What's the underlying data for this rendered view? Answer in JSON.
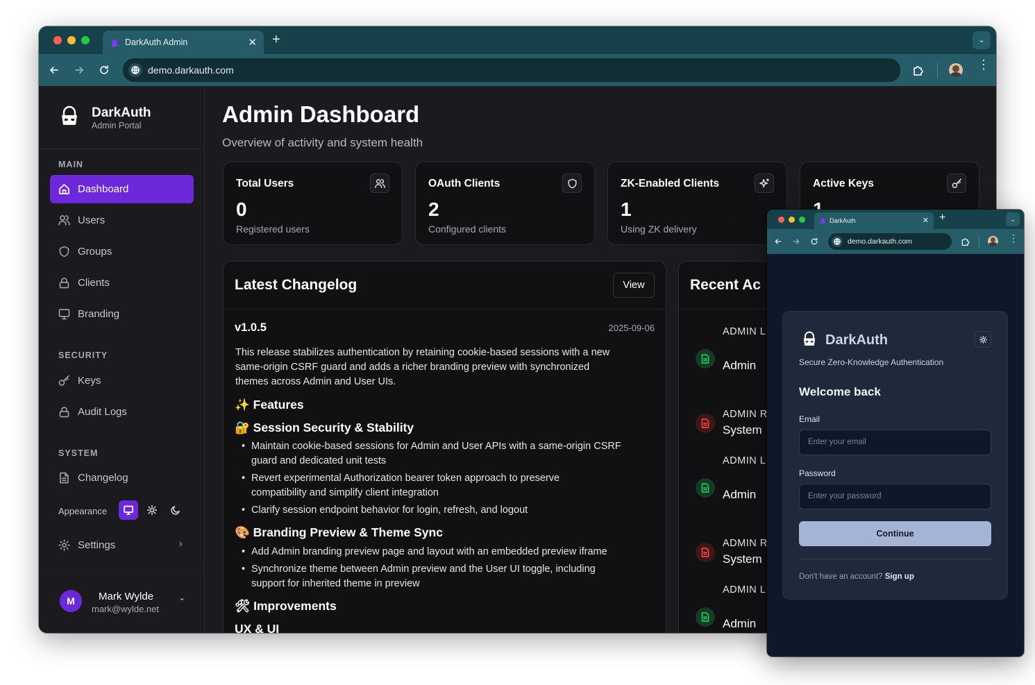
{
  "browser_main": {
    "tab_title": "DarkAuth Admin",
    "url": "demo.darkauth.com"
  },
  "sidebar": {
    "brand": "DarkAuth",
    "brand_sub": "Admin Portal",
    "sections": {
      "main": "MAIN",
      "security": "SECURITY",
      "system": "SYSTEM"
    },
    "items": [
      {
        "label": "Dashboard",
        "icon": "home-icon",
        "active": true
      },
      {
        "label": "Users",
        "icon": "users-icon"
      },
      {
        "label": "Groups",
        "icon": "shield-icon"
      },
      {
        "label": "Clients",
        "icon": "lock-icon"
      },
      {
        "label": "Branding",
        "icon": "monitor-icon"
      },
      {
        "label": "Keys",
        "icon": "key-icon"
      },
      {
        "label": "Audit Logs",
        "icon": "lock-icon"
      },
      {
        "label": "Changelog",
        "icon": "file-icon"
      }
    ],
    "appearance_label": "Appearance",
    "settings_label": "Settings",
    "user": {
      "initial": "M",
      "name": "Mark Wylde",
      "email": "mark@wylde.net"
    }
  },
  "header": {
    "title": "Admin Dashboard",
    "subtitle": "Overview of activity and system health"
  },
  "stats": [
    {
      "title": "Total Users",
      "value": "0",
      "sub": "Registered users",
      "icon": "users-icon"
    },
    {
      "title": "OAuth Clients",
      "value": "2",
      "sub": "Configured clients",
      "icon": "shield-icon"
    },
    {
      "title": "ZK-Enabled Clients",
      "value": "1",
      "sub": "Using ZK delivery",
      "icon": "sparkles-icon"
    },
    {
      "title": "Active Keys",
      "value": "1",
      "sub": "",
      "icon": "key-icon"
    }
  ],
  "changelog": {
    "title": "Latest Changelog",
    "view_label": "View",
    "version": "v1.0.5",
    "date": "2025-09-06",
    "intro": [
      "This release stabilizes authentication by retaining cookie-based sessions with a new",
      "same-origin CSRF guard and adds a richer branding preview with synchronized",
      "themes across Admin and User UIs."
    ],
    "features_heading": "✨ Features",
    "session_heading": "🔐 Session Security & Stability",
    "session_bullets": [
      [
        "Maintain cookie-based sessions for Admin and User APIs with a same-origin CSRF",
        "guard and dedicated unit tests"
      ],
      [
        "Revert experimental Authorization bearer token approach to preserve",
        "compatibility and simplify client integration"
      ],
      [
        "Clarify session endpoint behavior for login, refresh, and logout"
      ]
    ],
    "branding_heading": "🎨 Branding Preview & Theme Sync",
    "branding_bullets": [
      [
        "Add Admin branding preview page and layout with an embedded preview iframe"
      ],
      [
        "Synchronize theme between Admin preview and the User UI toggle, including",
        "support for inherited theme in preview"
      ]
    ],
    "improvements_heading": "🛠 Improvements",
    "ux_heading": "UX & UI"
  },
  "recent_activity": {
    "title": "Recent Ac",
    "items": [
      {
        "tag": "ADMIN L",
        "main": "Admin",
        "status": "success"
      },
      {
        "tag": "ADMIN R",
        "main": "System",
        "status": "error"
      },
      {
        "tag": "ADMIN L",
        "main": "Admin",
        "status": "success"
      },
      {
        "tag": "ADMIN R",
        "main": "System",
        "status": "error"
      },
      {
        "tag": "ADMIN L",
        "main": "Admin",
        "status": "success"
      }
    ]
  },
  "browser_popup": {
    "tab_title": "DarkAuth",
    "url": "demo.darkauth.com"
  },
  "login": {
    "brand": "DarkAuth",
    "tagline": "Secure Zero-Knowledge Authentication",
    "heading": "Welcome back",
    "email_label": "Email",
    "email_placeholder": "Enter your email",
    "password_label": "Password",
    "password_placeholder": "Enter your password",
    "continue_label": "Continue",
    "signup_prompt": "Don't have an account?",
    "signup_link": "Sign up"
  },
  "colors": {
    "accent": "#6d28d9",
    "chrome_bar": "#265c68",
    "success": "#22c55e",
    "error": "#ef4444"
  }
}
